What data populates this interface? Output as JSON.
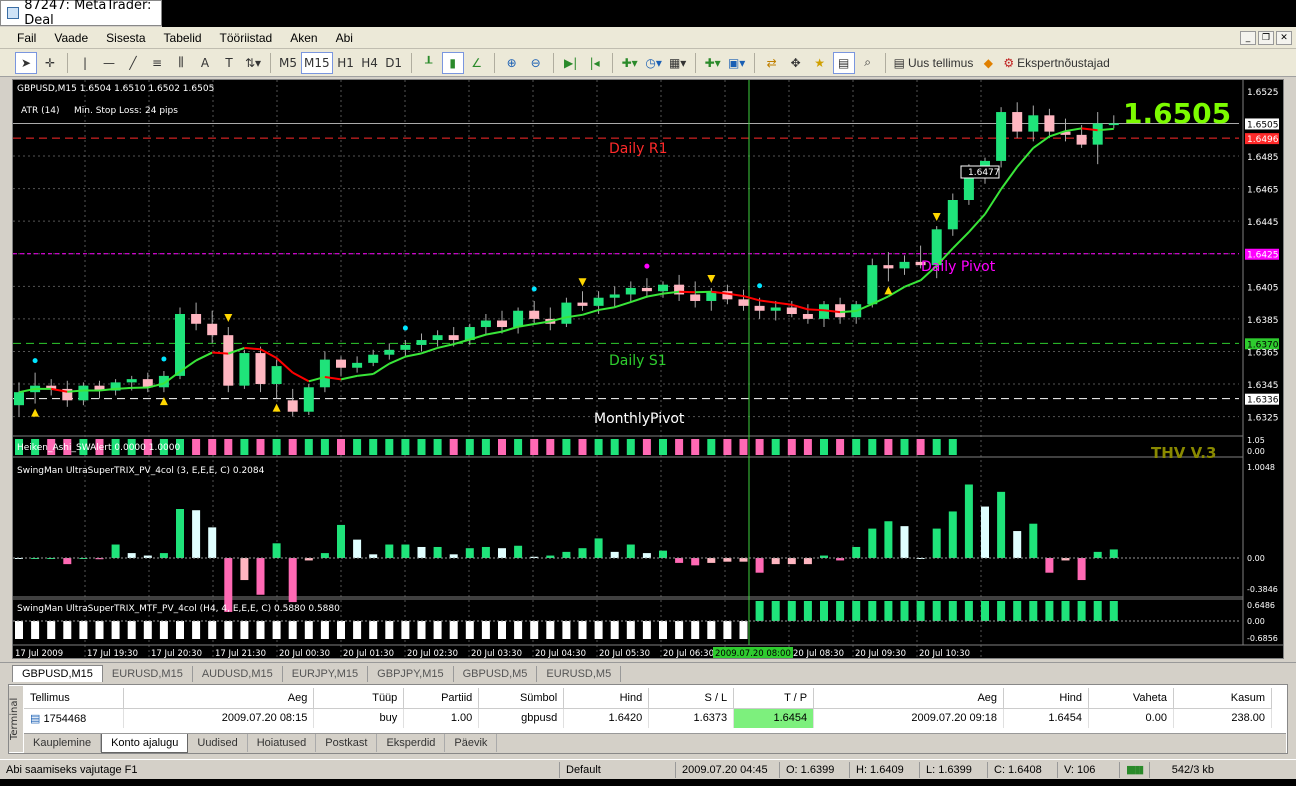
{
  "window": {
    "title": "87247: MetaTrader: Deal"
  },
  "menu": [
    "Fail",
    "Vaade",
    "Sisesta",
    "Tabelid",
    "Tööriistad",
    "Aken",
    "Abi"
  ],
  "toolbar": {
    "timeframes": [
      "M5",
      "M15",
      "H1",
      "H4",
      "D1"
    ],
    "active_tf": "M15",
    "new_order": "Uus tellimus",
    "expert": "Ekspertnõustajad"
  },
  "chart": {
    "symbol_info": "GBPUSD,M15  1.6504 1.6510 1.6502 1.6505",
    "atr_label": "ATR (14)",
    "stop_label": "Min. Stop Loss:",
    "stop_value": "24 pips",
    "big_price": "1.6505",
    "labels": {
      "r1": "Daily R1",
      "pivot": "Daily Pivot",
      "s1": "Daily S1",
      "monthly": "MonthlyPivot"
    },
    "price_ticks": [
      "1.6525",
      "1.6505",
      "1.6496",
      "1.6485",
      "1.6465",
      "1.6445",
      "1.6425",
      "1.6405",
      "1.6385",
      "1.6370",
      "1.6365",
      "1.6345",
      "1.6336",
      "1.6325"
    ],
    "tag_price": "1.6477",
    "ha_label": "Heiken_Ashi_SWAlert 0.0000 1.0000",
    "ha_ticks": [
      "1.05",
      "0.00"
    ],
    "thv": "THV V.3",
    "trix1_label": "SwingMan UltraSuperTRIX_PV_4col (3, E,E,E, C) 0.2084",
    "trix1_ticks": [
      "1.0048",
      "0.00",
      "-0.3846"
    ],
    "trix2_label": "SwingMan UltraSuperTRIX_MTF_PV_4col (H4, 4, E,E,E, C) 0.5880 0.5880",
    "trix2_ticks": [
      "0.6486",
      "0.00",
      "-0.6856"
    ],
    "time_ticks": [
      "17 Jul 2009",
      "17 Jul 19:30",
      "17 Jul 20:30",
      "17 Jul 21:30",
      "20 Jul 00:30",
      "20 Jul 01:30",
      "20 Jul 02:30",
      "20 Jul 03:30",
      "20 Jul 04:30",
      "20 Jul 05:30",
      "20 Jul 06:30",
      "2009.07.20 08:00",
      "20 Jul 08:30",
      "20 Jul 09:30",
      "20 Jul 10:30"
    ],
    "colors": {
      "bull": "#1fe37a",
      "bear": "#ffb6c1",
      "ma_up": "#39e639",
      "ma_down": "#ff0000",
      "r1": "#ff2a2a",
      "pivot": "#ff00ff",
      "s1": "#2ecc2e",
      "big_price": "#7CFC00"
    }
  },
  "chart_data": {
    "type": "candlestick",
    "symbol": "GBPUSD,M15",
    "ylim": [
      1.6318,
      1.6528
    ],
    "levels": {
      "daily_r1": 1.6496,
      "daily_pivot": 1.6425,
      "daily_s1": 1.637,
      "monthly_pivot": 1.6336
    },
    "ohlc": [
      [
        1.6332,
        1.6346,
        1.6325,
        1.634
      ],
      [
        1.634,
        1.6352,
        1.6333,
        1.6344
      ],
      [
        1.6344,
        1.6348,
        1.6338,
        1.6342
      ],
      [
        1.6342,
        1.6347,
        1.6331,
        1.6335
      ],
      [
        1.6335,
        1.6346,
        1.6332,
        1.6344
      ],
      [
        1.6344,
        1.6347,
        1.6336,
        1.6341
      ],
      [
        1.6341,
        1.6348,
        1.6338,
        1.6346
      ],
      [
        1.6346,
        1.635,
        1.6341,
        1.6348
      ],
      [
        1.6348,
        1.6352,
        1.634,
        1.6343
      ],
      [
        1.6343,
        1.6353,
        1.634,
        1.635
      ],
      [
        1.635,
        1.6392,
        1.6348,
        1.6388
      ],
      [
        1.6388,
        1.6395,
        1.6378,
        1.6382
      ],
      [
        1.6382,
        1.639,
        1.637,
        1.6375
      ],
      [
        1.6375,
        1.638,
        1.634,
        1.6344
      ],
      [
        1.6344,
        1.6366,
        1.6342,
        1.6364
      ],
      [
        1.6364,
        1.6368,
        1.634,
        1.6345
      ],
      [
        1.6345,
        1.636,
        1.6336,
        1.6356
      ],
      [
        1.6335,
        1.6342,
        1.6325,
        1.6328
      ],
      [
        1.6328,
        1.6345,
        1.6326,
        1.6343
      ],
      [
        1.6343,
        1.6365,
        1.634,
        1.636
      ],
      [
        1.636,
        1.6362,
        1.635,
        1.6355
      ],
      [
        1.6355,
        1.6362,
        1.6352,
        1.6358
      ],
      [
        1.6358,
        1.6366,
        1.6356,
        1.6363
      ],
      [
        1.6363,
        1.637,
        1.636,
        1.6366
      ],
      [
        1.6366,
        1.6372,
        1.6362,
        1.6369
      ],
      [
        1.6369,
        1.6376,
        1.6365,
        1.6372
      ],
      [
        1.6372,
        1.6378,
        1.6368,
        1.6375
      ],
      [
        1.6375,
        1.638,
        1.6368,
        1.6372
      ],
      [
        1.6372,
        1.6382,
        1.6369,
        1.638
      ],
      [
        1.638,
        1.6388,
        1.6375,
        1.6384
      ],
      [
        1.6384,
        1.639,
        1.6376,
        1.638
      ],
      [
        1.638,
        1.6392,
        1.6376,
        1.639
      ],
      [
        1.639,
        1.6396,
        1.6382,
        1.6385
      ],
      [
        1.6385,
        1.6392,
        1.6378,
        1.6382
      ],
      [
        1.6382,
        1.6398,
        1.638,
        1.6395
      ],
      [
        1.6395,
        1.6402,
        1.639,
        1.6393
      ],
      [
        1.6393,
        1.6402,
        1.6388,
        1.6398
      ],
      [
        1.6398,
        1.6405,
        1.6392,
        1.64
      ],
      [
        1.64,
        1.6408,
        1.6395,
        1.6404
      ],
      [
        1.6404,
        1.641,
        1.6398,
        1.6402
      ],
      [
        1.6402,
        1.6408,
        1.6398,
        1.6406
      ],
      [
        1.6406,
        1.6412,
        1.6396,
        1.64
      ],
      [
        1.64,
        1.6408,
        1.6392,
        1.6396
      ],
      [
        1.6396,
        1.6404,
        1.639,
        1.6402
      ],
      [
        1.6402,
        1.6406,
        1.6394,
        1.6397
      ],
      [
        1.6397,
        1.6403,
        1.639,
        1.6393
      ],
      [
        1.6393,
        1.6398,
        1.6385,
        1.639
      ],
      [
        1.639,
        1.6396,
        1.6384,
        1.6392
      ],
      [
        1.6392,
        1.6396,
        1.6386,
        1.6388
      ],
      [
        1.6388,
        1.6394,
        1.6382,
        1.6385
      ],
      [
        1.6385,
        1.6396,
        1.638,
        1.6394
      ],
      [
        1.6394,
        1.6398,
        1.6382,
        1.6386
      ],
      [
        1.6386,
        1.6396,
        1.6382,
        1.6394
      ],
      [
        1.6394,
        1.6422,
        1.6392,
        1.6418
      ],
      [
        1.6418,
        1.6426,
        1.6408,
        1.6416
      ],
      [
        1.6416,
        1.6424,
        1.6412,
        1.642
      ],
      [
        1.642,
        1.643,
        1.6416,
        1.6418
      ],
      [
        1.6418,
        1.6442,
        1.641,
        1.644
      ],
      [
        1.644,
        1.6462,
        1.6436,
        1.6458
      ],
      [
        1.6458,
        1.648,
        1.6455,
        1.6478
      ],
      [
        1.6478,
        1.6484,
        1.6468,
        1.6482
      ],
      [
        1.6482,
        1.6515,
        1.6478,
        1.6512
      ],
      [
        1.6512,
        1.6518,
        1.6496,
        1.65
      ],
      [
        1.65,
        1.6516,
        1.6494,
        1.651
      ],
      [
        1.651,
        1.6514,
        1.6496,
        1.65
      ],
      [
        1.65,
        1.6508,
        1.6494,
        1.6498
      ],
      [
        1.6498,
        1.6504,
        1.649,
        1.6492
      ],
      [
        1.6492,
        1.6512,
        1.648,
        1.6505
      ],
      [
        1.6504,
        1.651,
        1.6502,
        1.6505
      ]
    ]
  },
  "tabs": {
    "symbols": [
      "GBPUSD,M15",
      "EURUSD,M15",
      "AUDUSD,M15",
      "EURJPY,M15",
      "GBPJPY,M15",
      "GBPUSD,M5",
      "EURUSD,M5"
    ]
  },
  "terminal": {
    "side_label": "Terminal",
    "headers": [
      "Tellimus",
      "Aeg",
      "Tüüp",
      "Partiid",
      "Sümbol",
      "Hind",
      "S / L",
      "T / P",
      "Aeg",
      "Hind",
      "Vaheta",
      "Kasum"
    ],
    "rows": [
      [
        "1754468",
        "2009.07.20 08:15",
        "buy",
        "1.00",
        "gbpusd",
        "1.6420",
        "1.6373",
        "1.6454",
        "2009.07.20 09:18",
        "1.6454",
        "0.00",
        "238.00"
      ]
    ],
    "tabs": [
      "Kauplemine",
      "Konto ajalugu",
      "Uudised",
      "Hoiatused",
      "Postkast",
      "Eksperdid",
      "Päevik"
    ],
    "active_tab": "Konto ajalugu"
  },
  "status": {
    "hint": "Abi saamiseks vajutage F1",
    "profile": "Default",
    "time": "2009.07.20 04:45",
    "o": "O: 1.6399",
    "h": "H: 1.6409",
    "l": "L: 1.6399",
    "c": "C: 1.6408",
    "v": "V: 106",
    "traffic": "542/3 kb"
  }
}
